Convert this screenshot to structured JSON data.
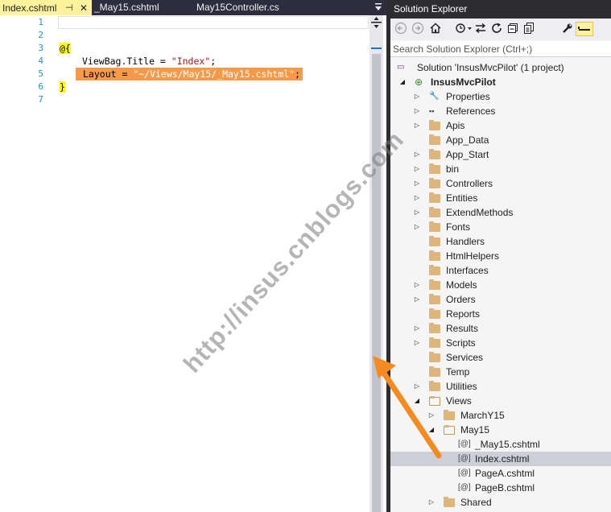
{
  "editor": {
    "tabs": [
      {
        "label": "Index.cshtml",
        "pin": "⊣",
        "close": "✕"
      },
      {
        "label": "_May15.cshtml"
      },
      {
        "label": "May15Controller.cs"
      }
    ],
    "line_numbers": [
      "1",
      "2",
      "3",
      "4",
      "5",
      "6",
      "7"
    ],
    "code": {
      "line3": "@{",
      "line4_prefix": "ViewBag.Title = ",
      "line4_string": "\"Index\"",
      "line4_suffix": ";",
      "line5_prefix": "Layout = ",
      "line5_string": "\"~/Views/May15/_May15.cshtml\"",
      "line5_suffix": ";",
      "line6": "}"
    }
  },
  "solution_explorer": {
    "title": "Solution Explorer",
    "search_placeholder": "Search Solution Explorer (Ctrl+;)",
    "tree": [
      {
        "label": "Solution 'InsusMvcPilot' (1 project)",
        "icon": "solution-icon"
      },
      {
        "label": "InsusMvcPilot",
        "icon": "web-project-icon"
      },
      {
        "label": "Properties",
        "icon": "wrench-icon"
      },
      {
        "label": "References",
        "icon": "references-icon"
      },
      {
        "label": "Apis",
        "icon": "folder-icon"
      },
      {
        "label": "App_Data",
        "icon": "folder-icon"
      },
      {
        "label": "App_Start",
        "icon": "folder-icon"
      },
      {
        "label": "bin",
        "icon": "folder-icon"
      },
      {
        "label": "Controllers",
        "icon": "folder-icon"
      },
      {
        "label": "Entities",
        "icon": "folder-icon"
      },
      {
        "label": "ExtendMethods",
        "icon": "folder-icon"
      },
      {
        "label": "Fonts",
        "icon": "folder-icon"
      },
      {
        "label": "Handlers",
        "icon": "folder-icon"
      },
      {
        "label": "HtmlHelpers",
        "icon": "folder-icon"
      },
      {
        "label": "Interfaces",
        "icon": "folder-icon"
      },
      {
        "label": "Models",
        "icon": "folder-icon"
      },
      {
        "label": "Orders",
        "icon": "folder-icon"
      },
      {
        "label": "Reports",
        "icon": "folder-icon"
      },
      {
        "label": "Results",
        "icon": "folder-icon"
      },
      {
        "label": "Scripts",
        "icon": "folder-icon"
      },
      {
        "label": "Services",
        "icon": "folder-icon"
      },
      {
        "label": "Temp",
        "icon": "folder-icon"
      },
      {
        "label": "Utilities",
        "icon": "folder-icon"
      },
      {
        "label": "Views",
        "icon": "folder-open-icon"
      },
      {
        "label": "MarchY15",
        "icon": "folder-icon"
      },
      {
        "label": "May15",
        "icon": "folder-open-icon"
      },
      {
        "label": "_May15.cshtml",
        "icon": "razor-file-icon"
      },
      {
        "label": "Index.cshtml",
        "icon": "razor-file-icon",
        "selected": true
      },
      {
        "label": "PageA.cshtml",
        "icon": "razor-file-icon"
      },
      {
        "label": "PageB.cshtml",
        "icon": "razor-file-icon"
      },
      {
        "label": "Shared",
        "icon": "folder-icon"
      }
    ]
  },
  "watermark": "http://insus.cnblogs.com",
  "colors": {
    "active_tab": "#fff29d",
    "highlight_line": "#f49a4a",
    "arrow": "#f58a1f",
    "selection": "#ccced8"
  }
}
